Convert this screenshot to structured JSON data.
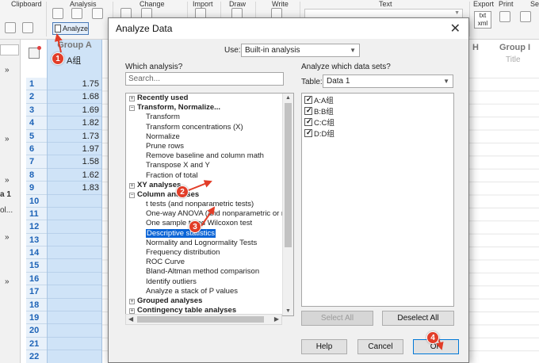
{
  "ribbon": {
    "groups": [
      "Clipboard",
      "Analysis",
      "Change",
      "Import",
      "Draw",
      "Write",
      "Text",
      "Export",
      "Print",
      "Se"
    ],
    "analyze_label": "Analyze",
    "txt_badge": "txt xml"
  },
  "leftnav": {
    "items": [
      "»",
      "»",
      "»",
      "a 1",
      "ol...",
      "»",
      "»"
    ]
  },
  "sheet": {
    "column_a_header": "Group A",
    "column_a_title": "A组",
    "values": [
      "1.75",
      "1.68",
      "1.69",
      "1.82",
      "1.73",
      "1.97",
      "1.58",
      "1.62",
      "1.83"
    ],
    "row_numbers": [
      "1",
      "2",
      "3",
      "4",
      "5",
      "6",
      "7",
      "8",
      "9",
      "10",
      "11",
      "12",
      "13",
      "14",
      "15",
      "16",
      "17",
      "18",
      "19",
      "20",
      "21",
      "22"
    ],
    "col_h_header": "H",
    "col_i_header": "Group I",
    "col_i_title": "Title"
  },
  "dialog": {
    "title": "Analyze Data",
    "use_label": "Use:",
    "use_value": "Built-in analysis",
    "which_label": "Which analysis?",
    "search_placeholder": "Search...",
    "datasets_label": "Analyze which data sets?",
    "table_label": "Table:",
    "table_value": "Data 1",
    "tree": [
      {
        "text": "Recently used",
        "kind": "cat",
        "toggle": "+"
      },
      {
        "text": "Transform, Normalize...",
        "kind": "cat",
        "toggle": "−"
      },
      {
        "text": "Transform",
        "kind": "leaf"
      },
      {
        "text": "Transform concentrations (X)",
        "kind": "leaf"
      },
      {
        "text": "Normalize",
        "kind": "leaf"
      },
      {
        "text": "Prune rows",
        "kind": "leaf"
      },
      {
        "text": "Remove baseline and column math",
        "kind": "leaf"
      },
      {
        "text": "Transpose X and Y",
        "kind": "leaf"
      },
      {
        "text": "Fraction of total",
        "kind": "leaf"
      },
      {
        "text": "XY analyses",
        "kind": "cat",
        "toggle": "+"
      },
      {
        "text": "Column analyses",
        "kind": "cat",
        "toggle": "−"
      },
      {
        "text": "t tests (and nonparametric tests)",
        "kind": "leaf"
      },
      {
        "text": "One-way ANOVA (and nonparametric or mi",
        "kind": "leaf"
      },
      {
        "text": "One sample t and Wilcoxon test",
        "kind": "leaf"
      },
      {
        "text": "Descriptive statistics",
        "kind": "leaf",
        "selected": true
      },
      {
        "text": "Normality and Lognormality Tests",
        "kind": "leaf"
      },
      {
        "text": "Frequency distribution",
        "kind": "leaf"
      },
      {
        "text": "ROC Curve",
        "kind": "leaf"
      },
      {
        "text": "Bland-Altman method comparison",
        "kind": "leaf"
      },
      {
        "text": "Identify outliers",
        "kind": "leaf"
      },
      {
        "text": "Analyze a stack of P values",
        "kind": "leaf"
      },
      {
        "text": "Grouped analyses",
        "kind": "cat",
        "toggle": "+"
      },
      {
        "text": "Contingency table analyses",
        "kind": "cat",
        "toggle": "+"
      }
    ],
    "datasets": [
      {
        "label": "A:A组",
        "checked": true
      },
      {
        "label": "B:B组",
        "checked": true
      },
      {
        "label": "C:C组",
        "checked": true
      },
      {
        "label": "D:D组",
        "checked": true
      }
    ],
    "select_all": "Select All",
    "deselect_all": "Deselect All",
    "help": "Help",
    "cancel": "Cancel",
    "ok": "OK"
  },
  "markers": [
    "1",
    "2",
    "3",
    "4"
  ],
  "colors": {
    "marker": "#e23d28",
    "selection": "#0a64d6",
    "row_number": "#1d63b7",
    "column_fill": "#cfe3f7"
  }
}
